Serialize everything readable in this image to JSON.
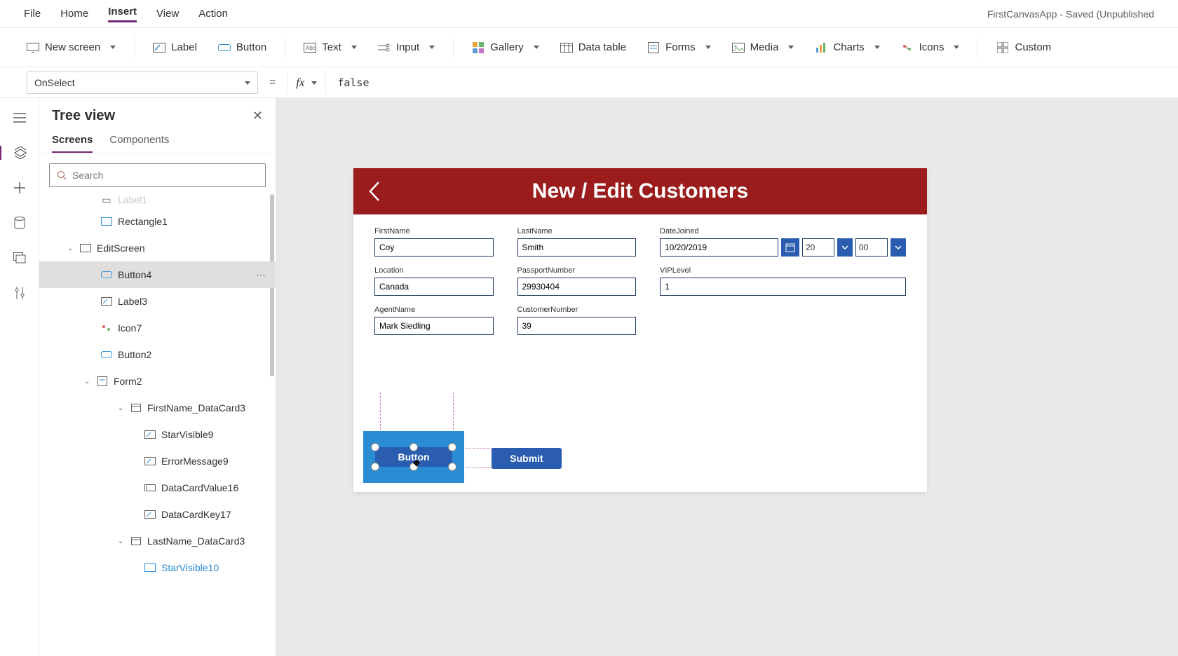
{
  "menubar": {
    "file": "File",
    "home": "Home",
    "insert": "Insert",
    "view": "View",
    "action": "Action",
    "title_right": "FirstCanvasApp - Saved (Unpublished"
  },
  "ribbon": {
    "new_screen": "New screen",
    "label": "Label",
    "button": "Button",
    "text": "Text",
    "input": "Input",
    "gallery": "Gallery",
    "data_table": "Data table",
    "forms": "Forms",
    "media": "Media",
    "charts": "Charts",
    "icons": "Icons",
    "custom": "Custom"
  },
  "formula": {
    "property": "OnSelect",
    "equals": "=",
    "fx": "fx",
    "value": "false"
  },
  "tree": {
    "title": "Tree view",
    "tab_screens": "Screens",
    "tab_components": "Components",
    "search_placeholder": "Search",
    "items": {
      "label1": "Label1",
      "rectangle1": "Rectangle1",
      "editscreen": "EditScreen",
      "button4": "Button4",
      "label3": "Label3",
      "icon7": "Icon7",
      "button2": "Button2",
      "form2": "Form2",
      "firstname_dc": "FirstName_DataCard3",
      "starvisible9": "StarVisible9",
      "errormessage9": "ErrorMessage9",
      "datacardvalue16": "DataCardValue16",
      "datacardkey17": "DataCardKey17",
      "lastname_dc": "LastName_DataCard3",
      "starvisible10": "StarVisible10"
    }
  },
  "canvas": {
    "header_title": "New / Edit Customers",
    "fields": {
      "firstname_label": "FirstName",
      "firstname_value": "Coy",
      "lastname_label": "LastName",
      "lastname_value": "Smith",
      "datejoined_label": "DateJoined",
      "datejoined_value": "10/20/2019",
      "datejoined_hour": "20",
      "datejoined_min": "00",
      "location_label": "Location",
      "location_value": "Canada",
      "passport_label": "PassportNumber",
      "passport_value": "29930404",
      "viplevel_label": "VIPLevel",
      "viplevel_value": "1",
      "agentname_label": "AgentName",
      "agentname_value": "Mark Siedling",
      "customerno_label": "CustomerNumber",
      "customerno_value": "39"
    },
    "selected_button_label": "Button",
    "submit_label": "Submit"
  }
}
